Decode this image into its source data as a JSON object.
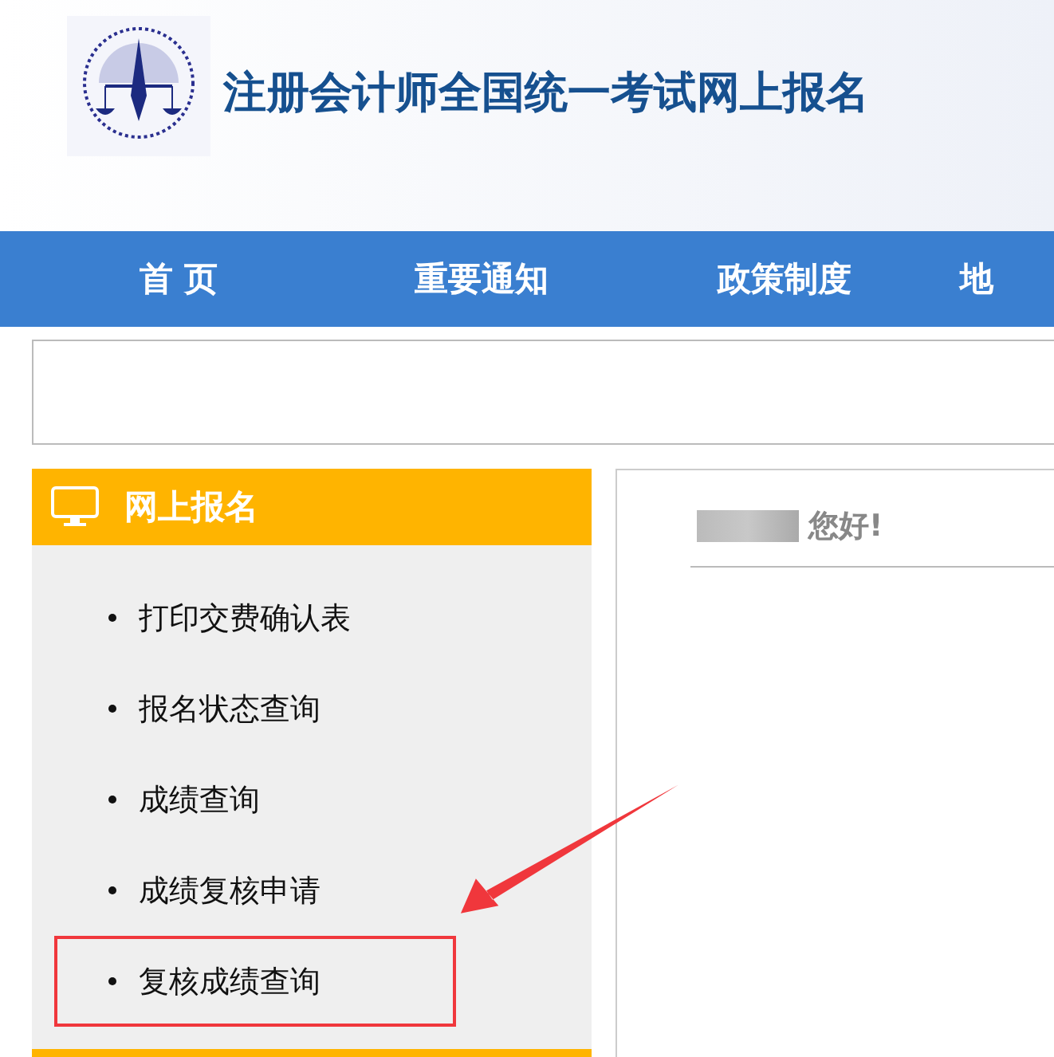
{
  "header": {
    "title": "注册会计师全国统一考试网上报名"
  },
  "nav": [
    {
      "label": "首 页"
    },
    {
      "label": "重要通知"
    },
    {
      "label": "政策制度"
    },
    {
      "label": "地"
    }
  ],
  "sidebar": {
    "title": "网上报名",
    "items": [
      {
        "label": "打印交费确认表",
        "highlighted": false
      },
      {
        "label": "报名状态查询",
        "highlighted": false
      },
      {
        "label": "成绩查询",
        "highlighted": false
      },
      {
        "label": "成绩复核申请",
        "highlighted": false
      },
      {
        "label": "复核成绩查询",
        "highlighted": true
      }
    ]
  },
  "main": {
    "greeting": "您好!"
  }
}
